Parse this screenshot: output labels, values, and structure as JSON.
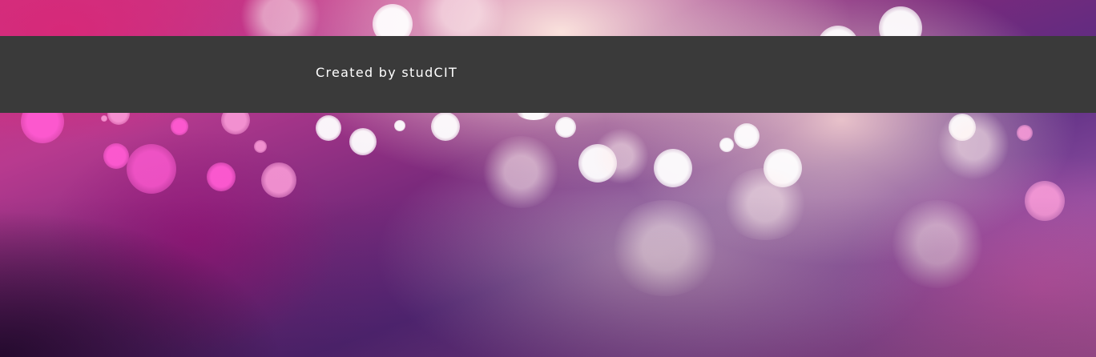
{
  "footer": {
    "credit_text": "Created by studCIT",
    "background_color": "#3a3a3a",
    "text_color": "#ffffff"
  },
  "background": {
    "description_colors": [
      "#d3317f",
      "#7a2a7c",
      "#5a2c82",
      "#ffe8e0"
    ]
  }
}
